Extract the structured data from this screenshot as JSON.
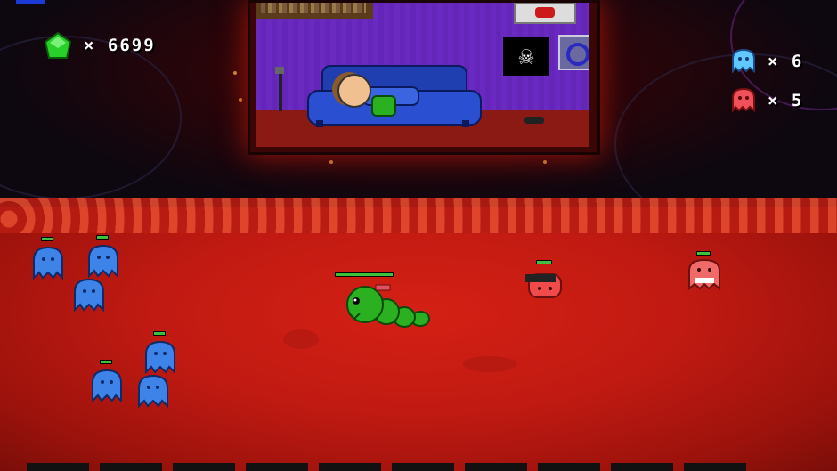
{
  "hud": {
    "gem_count": "× 6699",
    "gem_icon": "green-gem-icon",
    "blue_count": "× 6",
    "blue_icon": "blue-ghost-icon",
    "red_count": "× 5",
    "red_icon": "red-ghost-icon"
  },
  "colors": {
    "floor": "#c01a12",
    "blue_enemy": "#3e84e8",
    "red_enemy": "#f04a4a",
    "player": "#2ab020",
    "health": "#3ec23e"
  }
}
